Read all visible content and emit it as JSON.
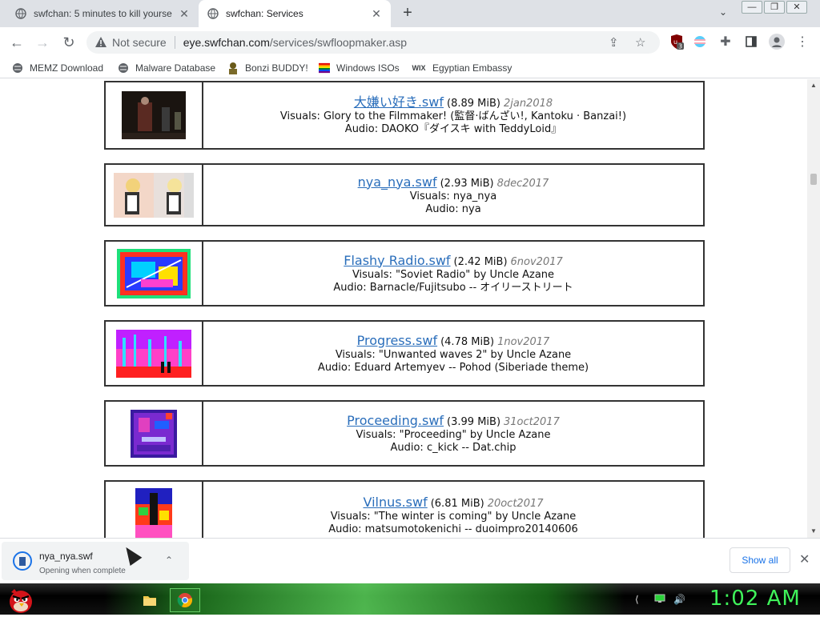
{
  "browser": {
    "tabs": [
      {
        "title": "swfchan: 5 minutes to kill yourse",
        "active": false
      },
      {
        "title": "swfchan: Services",
        "active": true
      }
    ],
    "address": {
      "security_label": "Not secure",
      "host": "eye.swfchan.com",
      "path": "/services/swfloopmaker.asp"
    },
    "extension_badge": "3",
    "bookmarks": [
      {
        "label": "MEMZ Download",
        "icon": "globe-icon"
      },
      {
        "label": "Malware Database",
        "icon": "globe-icon"
      },
      {
        "label": "Bonzi BUDDY!",
        "icon": "bonzi-icon"
      },
      {
        "label": "Windows ISOs",
        "icon": "rainbow-flag-icon"
      },
      {
        "label": "Egyptian Embassy",
        "icon": "wix-icon"
      }
    ]
  },
  "entries": [
    {
      "name": "大嫌い好き.swf",
      "size": "(8.89 MiB)",
      "date": "2jan2018",
      "visuals": "Visuals: Glory to the Filmmaker! (監督·ばんざい!, Kantoku · Banzai!)",
      "audio": "Audio: DAOKO『ダイスキ with TeddyLoid』"
    },
    {
      "name": "nya_nya.swf",
      "size": "(2.93 MiB)",
      "date": "8dec2017",
      "visuals": "Visuals: nya_nya",
      "audio": "Audio: nya"
    },
    {
      "name": "Flashy Radio.swf",
      "size": "(2.42 MiB)",
      "date": "6nov2017",
      "visuals": "Visuals: \"Soviet Radio\" by Uncle Azane",
      "audio": "Audio: Barnacle/Fujitsubo -- オイリーストリート"
    },
    {
      "name": "Progress.swf",
      "size": "(4.78 MiB)",
      "date": "1nov2017",
      "visuals": "Visuals: \"Unwanted waves 2\" by Uncle Azane",
      "audio": "Audio: Eduard Artemyev -- Pohod (Siberiade theme)"
    },
    {
      "name": "Proceeding.swf",
      "size": "(3.99 MiB)",
      "date": "31oct2017",
      "visuals": "Visuals: \"Proceeding\" by Uncle Azane",
      "audio": "Audio: c_kick -- Dat.chip"
    },
    {
      "name": "Vilnus.swf",
      "size": "(6.81 MiB)",
      "date": "20oct2017",
      "visuals": "Visuals: \"The winter is coming\" by Uncle Azane",
      "audio": "Audio: matsumotokenichi -- duoimpro20140606"
    }
  ],
  "download": {
    "filename": "nya_nya.swf",
    "status": "Opening when complete",
    "show_all": "Show all"
  },
  "taskbar": {
    "clock": "1:02 AM"
  },
  "colors": {
    "link": "#2a6ebb",
    "clock": "#3ff25a",
    "tabbar": "#dee1e6"
  }
}
